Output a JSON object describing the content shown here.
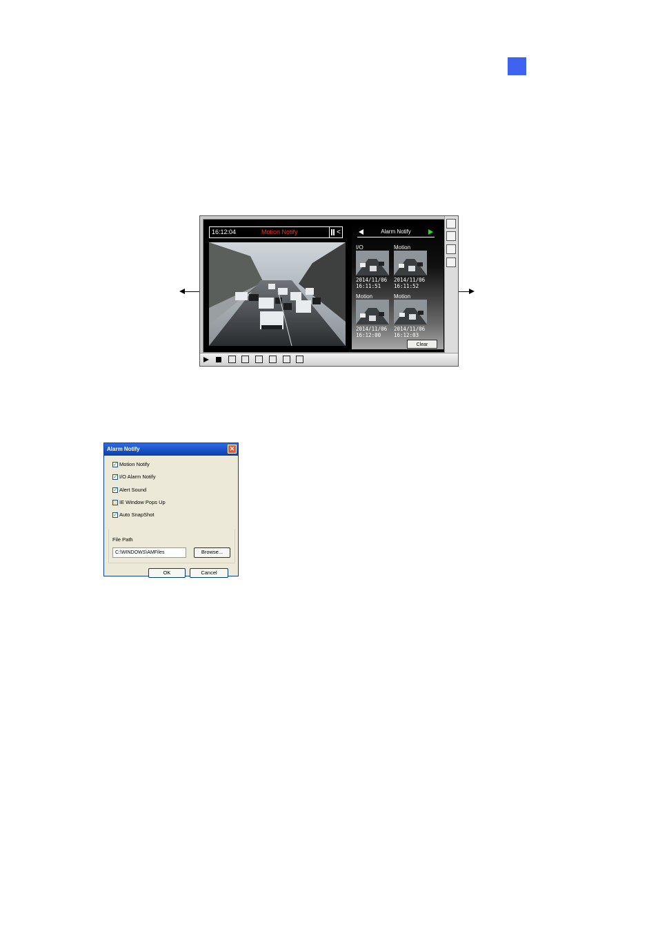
{
  "viewer": {
    "timestamp": "16:12:04",
    "status": "Motion Notify",
    "alarm_panel": {
      "title": "Alarm Notify",
      "thumbnails": [
        {
          "type": "I/O",
          "date": "2014/11/06",
          "time": "16:11:51"
        },
        {
          "type": "Motion",
          "date": "2014/11/06",
          "time": "16:11:52"
        },
        {
          "type": "Motion",
          "date": "2014/11/06",
          "time": "16:12:00"
        },
        {
          "type": "Motion",
          "date": "2014/11/06",
          "time": "16:12:03"
        }
      ],
      "clear_label": "Clear"
    }
  },
  "dialog": {
    "title": "Alarm Notify",
    "close": "✕",
    "options": [
      {
        "label": "Motion Notify",
        "checked": true
      },
      {
        "label": "I/O Alarm Notify",
        "checked": true
      },
      {
        "label": "Alert Sound",
        "checked": true
      },
      {
        "label": "IE Window Pops Up",
        "checked": false
      },
      {
        "label": "Auto SnapShot",
        "checked": true
      }
    ],
    "file_path_label": "File Path",
    "file_path_value": "C:\\WINDOWS\\AMFiles",
    "browse_label": "Browse...",
    "ok_label": "OK",
    "cancel_label": "Cancel"
  },
  "colors": {
    "chapter_mark": "#3d63f0",
    "status_text": "#ff2a2a",
    "next_arrow": "#19e619"
  }
}
